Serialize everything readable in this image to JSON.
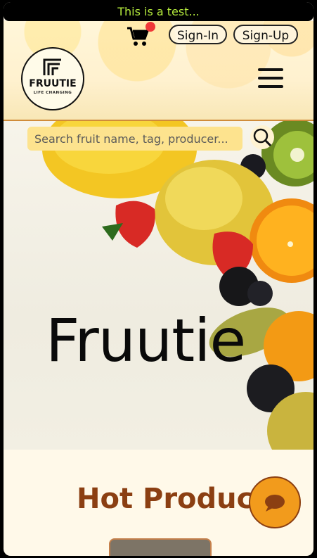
{
  "topbar": {
    "message": "This is a test..."
  },
  "header": {
    "sign_in_label": "Sign-In",
    "sign_up_label": "Sign-Up",
    "logo_name": "FRUUTIE",
    "logo_tagline": "LIFE CHANGING",
    "cart_icon": "cart-icon",
    "menu_icon": "hamburger-menu-icon"
  },
  "search": {
    "placeholder": "Search fruit name, tag, producer...",
    "button_icon": "search-icon"
  },
  "hero": {
    "title": "Fruutie"
  },
  "section": {
    "title": "Hot Product"
  },
  "chat": {
    "icon": "chat-bubble-icon"
  },
  "colors": {
    "accent": "#f29b1c",
    "heading": "#8b3f12",
    "topbar_text": "#b4ea3d",
    "search_bg": "#fde38e",
    "notification_dot": "#f03838"
  }
}
